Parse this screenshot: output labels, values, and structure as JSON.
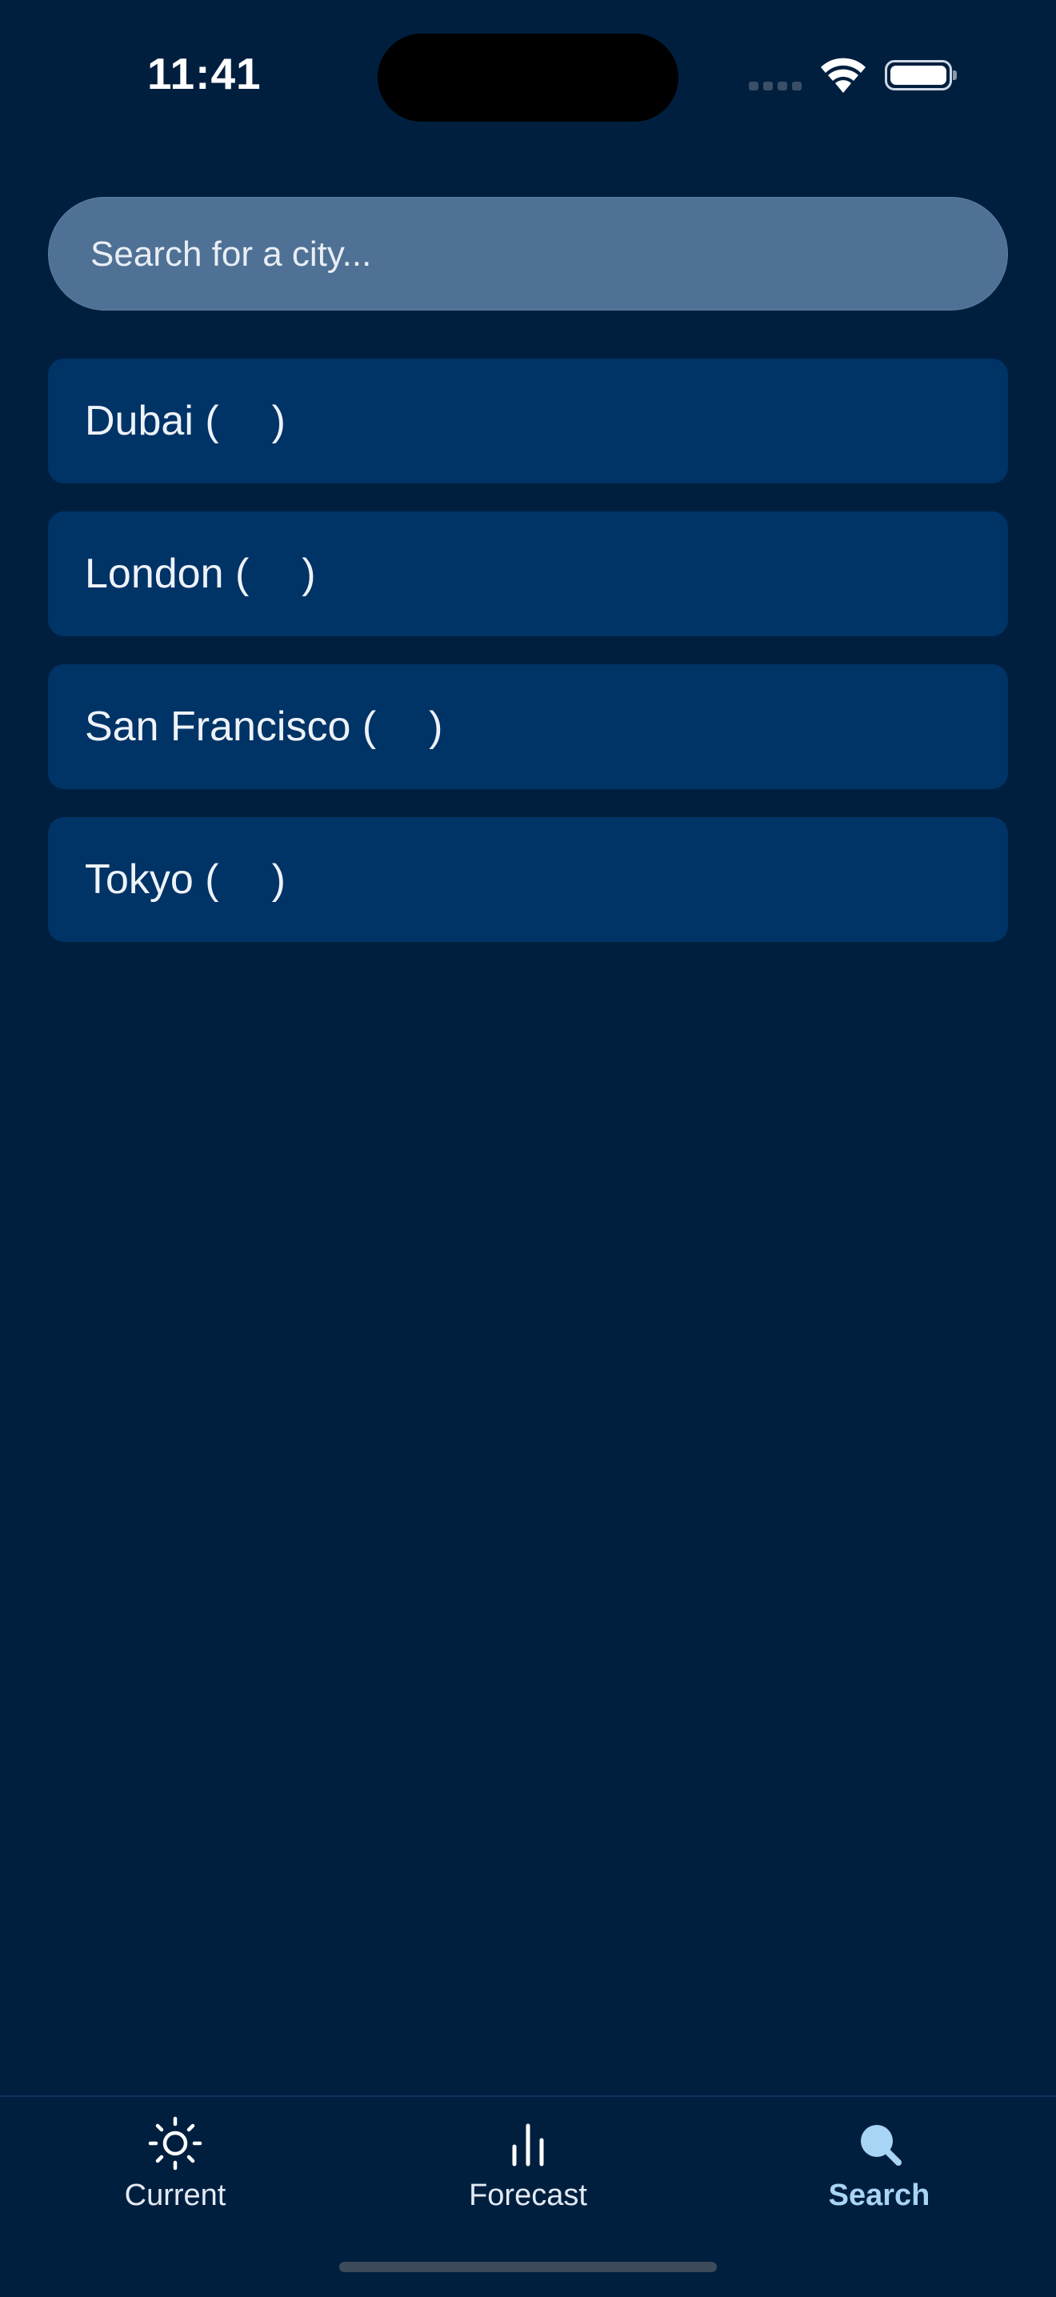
{
  "status_bar": {
    "time": "11:41"
  },
  "search": {
    "placeholder": "Search for a city..."
  },
  "cities": [
    {
      "name": "Dubai",
      "flag": "ae-flag-icon"
    },
    {
      "name": "London",
      "flag": "gb-flag-icon"
    },
    {
      "name": "San Francisco",
      "flag": "us-flag-icon"
    },
    {
      "name": "Tokyo",
      "flag": "jp-flag-icon"
    }
  ],
  "tabs": [
    {
      "label": "Current",
      "icon": "sun-icon",
      "active": false
    },
    {
      "label": "Forecast",
      "icon": "bar-chart-icon",
      "active": false
    },
    {
      "label": "Search",
      "icon": "search-icon",
      "active": true
    }
  ],
  "colors": {
    "background": "#001f3f",
    "list_item": "#003366",
    "search_field": "#4f7195",
    "active_tab": "#a8d4f5"
  }
}
